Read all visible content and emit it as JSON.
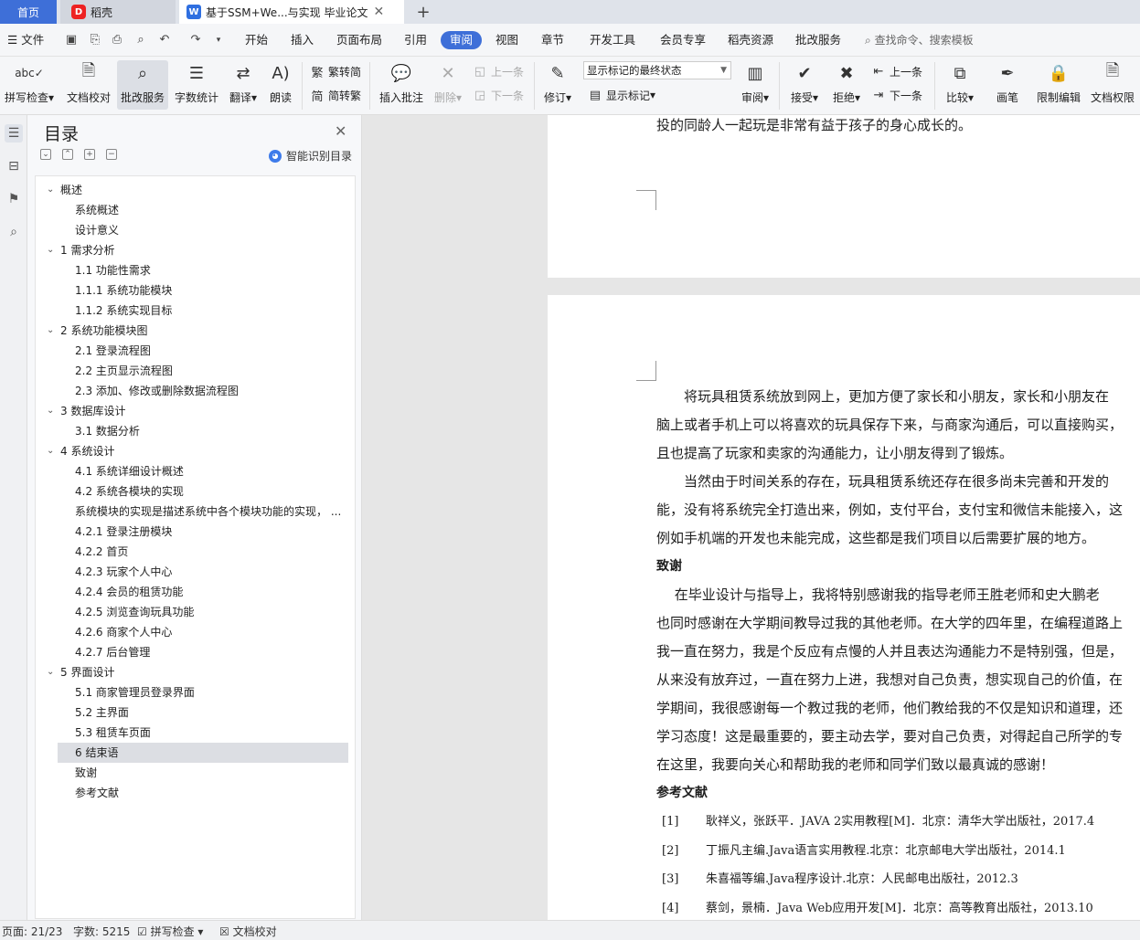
{
  "tabs": {
    "home": "首页",
    "daoke": "稻壳",
    "doc": "基于SSM+We...与实现 毕业论文",
    "close": "✕",
    "add": "+"
  },
  "menu": {
    "file": "文件",
    "items": [
      "开始",
      "插入",
      "页面布局",
      "引用",
      "审阅",
      "视图",
      "章节",
      "开发工具",
      "会员专享",
      "稻壳资源",
      "批改服务"
    ],
    "active": "审阅",
    "search": "查找命令、搜索模板"
  },
  "ribbon": {
    "spell": "拼写检查",
    "doccheck": "文档校对",
    "correct": "批改服务",
    "wordcount": "字数统计",
    "translate": "翻译",
    "read": "朗读",
    "to_trad": "繁转简",
    "to_simp": "简转繁",
    "insert_comment": "插入批注",
    "delete": "删除",
    "prev": "上一条",
    "next": "下一条",
    "revise": "修订",
    "markup_state": "显示标记的最终状态",
    "show_markup": "显示标记",
    "review": "审阅",
    "accept": "接受",
    "reject": "拒绝",
    "prev2": "上一条",
    "next2": "下一条",
    "compare": "比较",
    "pen": "画笔",
    "restrict": "限制编辑",
    "perm": "文档权限"
  },
  "toc": {
    "title": "目录",
    "smart": "智能识别目录",
    "items": [
      {
        "text": "概述",
        "level": 0,
        "arrow": true
      },
      {
        "text": "系统概述",
        "level": 1
      },
      {
        "text": "设计意义",
        "level": 1
      },
      {
        "text": "1  需求分析",
        "level": 0,
        "arrow": true
      },
      {
        "text": "1.1  功能性需求",
        "level": 1
      },
      {
        "text": "1.1.1  系统功能模块",
        "level": 1
      },
      {
        "text": "1.1.2  系统实现目标",
        "level": 1
      },
      {
        "text": "2  系统功能模块图",
        "level": 0,
        "arrow": true
      },
      {
        "text": "2.1  登录流程图",
        "level": 1
      },
      {
        "text": "2.2  主页显示流程图",
        "level": 1
      },
      {
        "text": "2.3  添加、修改或删除数据流程图",
        "level": 1
      },
      {
        "text": "3  数据库设计",
        "level": 0,
        "arrow": true
      },
      {
        "text": "3.1  数据分析",
        "level": 1
      },
      {
        "text": "4  系统设计",
        "level": 0,
        "arrow": true
      },
      {
        "text": "4.1  系统详细设计概述",
        "level": 1
      },
      {
        "text": "4.2 系统各模块的实现",
        "level": 1
      },
      {
        "text": "系统模块的实现是描述系统中各个模块功能的实现，  ...",
        "level": 1
      },
      {
        "text": "4.2.1  登录注册模块",
        "level": 1
      },
      {
        "text": "4.2.2  首页",
        "level": 1
      },
      {
        "text": "4.2.3  玩家个人中心",
        "level": 1
      },
      {
        "text": "4.2.4  会员的租赁功能",
        "level": 1
      },
      {
        "text": "4.2.5  浏览查询玩具功能",
        "level": 1
      },
      {
        "text": "4.2.6  商家个人中心",
        "level": 1
      },
      {
        "text": "4.2.7  后台管理",
        "level": 1
      },
      {
        "text": "5  界面设计",
        "level": 0,
        "arrow": true
      },
      {
        "text": "5.1  商家管理员登录界面",
        "level": 1
      },
      {
        "text": "5.2  主界面",
        "level": 1
      },
      {
        "text": "5.3  租赁车页面",
        "level": 1
      },
      {
        "text": "6  结束语",
        "level": 1,
        "selected": true
      },
      {
        "text": "致谢",
        "level": 1
      },
      {
        "text": "参考文献",
        "level": 1
      }
    ]
  },
  "document": {
    "page1_line": "投的同龄人一起玩是非常有益于孩子的身心成长的。",
    "para1": [
      "　　将玩具租赁系统放到网上，更加方便了家长和小朋友，家长和小朋友在",
      "脑上或者手机上可以将喜欢的玩具保存下来，与商家沟通后，可以直接购买，",
      "且也提高了玩家和卖家的沟通能力，让小朋友得到了锻炼。"
    ],
    "para2": [
      "　　当然由于时间关系的存在，玩具租赁系统还存在很多尚未完善和开发的",
      "能，没有将系统完全打造出来，例如，支付平台，支付宝和微信未能接入，这",
      "例如手机端的开发也未能完成，这些都是我们项目以后需要扩展的地方。"
    ],
    "thanks_heading": "致谢",
    "thanks": [
      "　 在毕业设计与指导上，我将特别感谢我的指导老师王胜老师和史大鹏老",
      "也同时感谢在大学期间教导过我的其他老师。在大学的四年里，在编程道路上",
      "我一直在努力，我是个反应有点慢的人并且表达沟通能力不是特别强，但是，",
      "从来没有放弃过，一直在努力上进，我想对自己负责，想实现自己的价值，在",
      "学期间，我很感谢每一个教过我的老师，他们教给我的不仅是知识和道理，还",
      "学习态度！这是最重要的，要主动去学，要对自己负责，对得起自己所学的专",
      "在这里，我要向关心和帮助我的老师和同学们致以最真诚的感谢！"
    ],
    "refs_heading": "参考文献",
    "refs": [
      {
        "num": "[1]",
        "text": "耿祥义，张跃平．JAVA 2实用教程[M]．北京：清华大学出版社，2017.4"
      },
      {
        "num": "[2]",
        "text": "丁振凡主编.Java语言实用教程.北京：北京邮电大学出版社，2014.1"
      },
      {
        "num": "[3]",
        "text": "朱喜福等编.Java程序设计.北京：人民邮电出版社，2012.3"
      },
      {
        "num": "[4]",
        "text": "蔡剑，景楠．Java Web应用开发[M]．北京：高等教育出版社，2013.10"
      }
    ]
  },
  "status": {
    "page": "页面: 21/23",
    "words": "字数: 5215",
    "spell": "拼写检查",
    "doccheck": "文档校对"
  },
  "colors": {
    "accent": "#3e6fd8",
    "wps_red": "#e22222"
  }
}
